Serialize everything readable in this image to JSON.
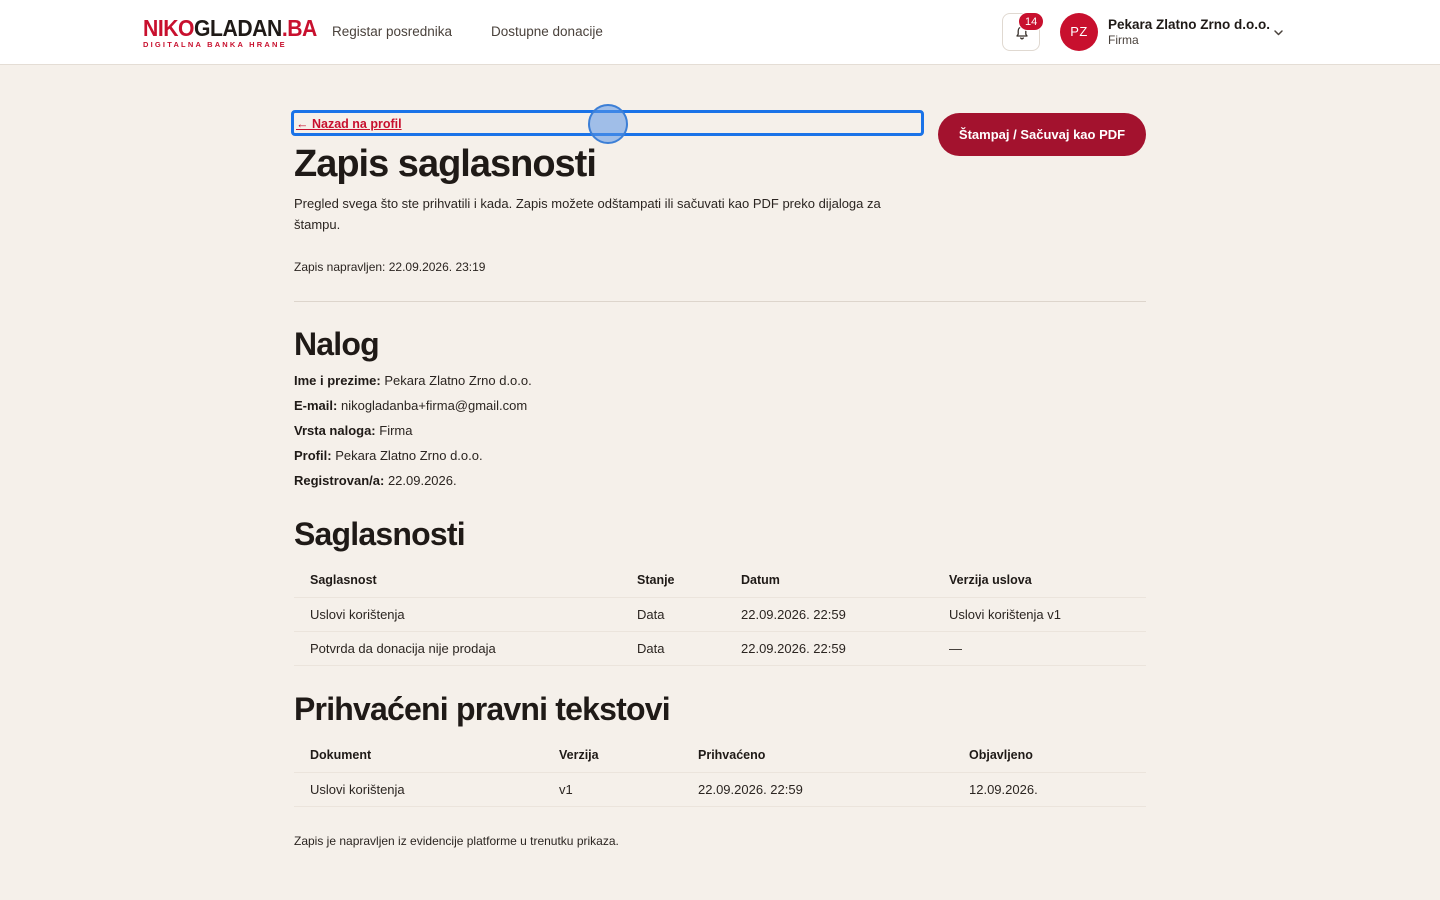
{
  "header": {
    "logo_red": "NIKO",
    "logo_dark": "GLADAN",
    "logo_red2": ".BA",
    "logo_tagline": "DIGITALNA BANKA HRANE",
    "nav": [
      "Registar posrednika",
      "Dostupne donacije"
    ],
    "notifications_count": "14",
    "avatar_initials": "PZ",
    "user_name": "Pekara Zlatno Zrno d.o.o.",
    "user_role": "Firma"
  },
  "page": {
    "back_link": "← Nazad na profil",
    "print_button": "Štampaj / Sačuvaj kao PDF",
    "title": "Zapis saglasnosti",
    "intro": "Pregled svega što ste prihvatili i kada. Zapis možete odštampati ili sačuvati kao PDF preko dijaloga za štampu.",
    "generated": "Zapis napravljen: 22.09.2026. 23:19"
  },
  "account": {
    "heading": "Nalog",
    "fields": [
      {
        "label": "Ime i prezime:",
        "value": "Pekara Zlatno Zrno d.o.o."
      },
      {
        "label": "E-mail:",
        "value": "nikogladanba+firma@gmail.com"
      },
      {
        "label": "Vrsta naloga:",
        "value": "Firma"
      },
      {
        "label": "Profil:",
        "value": "Pekara Zlatno Zrno d.o.o."
      },
      {
        "label": "Registrovan/a:",
        "value": "22.09.2026."
      }
    ]
  },
  "consents": {
    "heading": "Saglasnosti",
    "columns": [
      "Saglasnost",
      "Stanje",
      "Datum",
      "Verzija uslova"
    ],
    "rows": [
      [
        "Uslovi korištenja",
        "Data",
        "22.09.2026. 22:59",
        "Uslovi korištenja v1"
      ],
      [
        "Potvrda da donacija nije prodaja",
        "Data",
        "22.09.2026. 22:59",
        "—"
      ]
    ]
  },
  "legal": {
    "heading": "Prihvaćeni pravni tekstovi",
    "columns": [
      "Dokument",
      "Verzija",
      "Prihvaćeno",
      "Objavljeno"
    ],
    "rows": [
      [
        "Uslovi korištenja",
        "v1",
        "22.09.2026. 22:59",
        "12.09.2026."
      ]
    ]
  },
  "footer_note": "Zapis je napravljen iz evidencije platforme u trenutku prikaza.",
  "colors": {
    "brand": "#c8102e",
    "button": "#a3122e",
    "background": "#f5f0ea",
    "focus": "#1a73e8"
  }
}
